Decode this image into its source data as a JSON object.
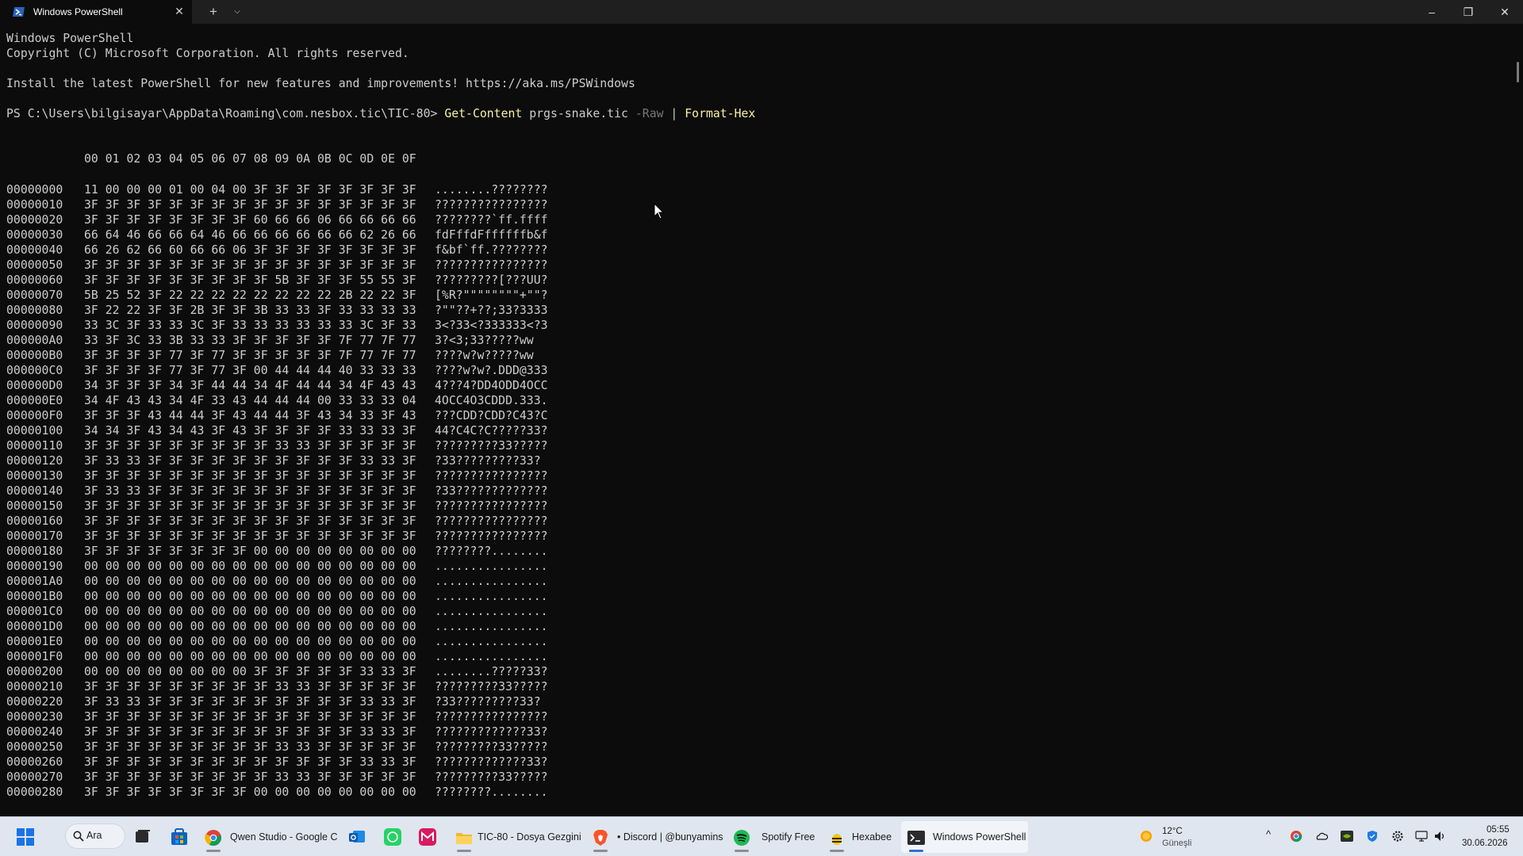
{
  "window": {
    "tab_title": "Windows PowerShell",
    "tab_close": "✕",
    "new_tab": "+",
    "tab_dropdown": "⌵",
    "minimize": "–",
    "maximize": "❐",
    "close": "✕"
  },
  "terminal": {
    "banner_1": "Windows PowerShell",
    "banner_2": "Copyright (C) Microsoft Corporation. All rights reserved.",
    "banner_3": "Install the latest PowerShell for new features and improvements! https://aka.ms/PSWindows",
    "prompt": "PS C:\\Users\\bilgisayar\\AppData\\Roaming\\com.nesbox.tic\\TIC-80> ",
    "cmd_1": "Get-Content",
    "arg_1": " prgs-snake.tic ",
    "param_1": "-Raw",
    "pipe": " | ",
    "cmd_2": "Format-Hex",
    "hex_header": "00 01 02 03 04 05 06 07 08 09 0A 0B 0C 0D 0E 0F",
    "rows": [
      {
        "offset": "00000000",
        "bytes": "11 00 00 00 01 00 04 00 3F 3F 3F 3F 3F 3F 3F 3F",
        "ascii": "........????????"
      },
      {
        "offset": "00000010",
        "bytes": "3F 3F 3F 3F 3F 3F 3F 3F 3F 3F 3F 3F 3F 3F 3F 3F",
        "ascii": "????????????????"
      },
      {
        "offset": "00000020",
        "bytes": "3F 3F 3F 3F 3F 3F 3F 3F 60 66 66 06 66 66 66 66",
        "ascii": "????????`ff.ffff"
      },
      {
        "offset": "00000030",
        "bytes": "66 64 46 66 66 64 46 66 66 66 66 66 66 62 26 66",
        "ascii": "fdFffdFffffffb&f"
      },
      {
        "offset": "00000040",
        "bytes": "66 26 62 66 60 66 66 06 3F 3F 3F 3F 3F 3F 3F 3F",
        "ascii": "f&bf`ff.????????"
      },
      {
        "offset": "00000050",
        "bytes": "3F 3F 3F 3F 3F 3F 3F 3F 3F 3F 3F 3F 3F 3F 3F 3F",
        "ascii": "????????????????"
      },
      {
        "offset": "00000060",
        "bytes": "3F 3F 3F 3F 3F 3F 3F 3F 3F 5B 3F 3F 3F 55 55 3F",
        "ascii": "?????????[???UU?"
      },
      {
        "offset": "00000070",
        "bytes": "5B 25 52 3F 22 22 22 22 22 22 22 22 2B 22 22 3F",
        "ascii": "[%R?\"\"\"\"\"\"\"\"+\"\"?"
      },
      {
        "offset": "00000080",
        "bytes": "3F 22 22 3F 3F 2B 3F 3F 3B 33 33 3F 33 33 33 33",
        "ascii": "?\"\"??+??;33?3333"
      },
      {
        "offset": "00000090",
        "bytes": "33 3C 3F 33 33 3C 3F 33 33 33 33 33 33 3C 3F 33",
        "ascii": "3<?33<?333333<?3"
      },
      {
        "offset": "000000A0",
        "bytes": "33 3F 3C 33 3B 33 33 3F 3F 3F 3F 3F 7F 77 7F 77",
        "ascii": "3?<3;33?????ww"
      },
      {
        "offset": "000000B0",
        "bytes": "3F 3F 3F 3F 77 3F 77 3F 3F 3F 3F 3F 7F 77 7F 77",
        "ascii": "????w?w?????ww"
      },
      {
        "offset": "000000C0",
        "bytes": "3F 3F 3F 3F 77 3F 77 3F 00 44 44 44 40 33 33 33",
        "ascii": "????w?w?.DDD@333"
      },
      {
        "offset": "000000D0",
        "bytes": "34 3F 3F 3F 34 3F 44 44 34 4F 44 44 34 4F 43 43",
        "ascii": "4???4?DD4ODD4OCC"
      },
      {
        "offset": "000000E0",
        "bytes": "34 4F 43 43 34 4F 33 43 44 44 44 00 33 33 33 04",
        "ascii": "4OCC4O3CDDD.333."
      },
      {
        "offset": "000000F0",
        "bytes": "3F 3F 3F 43 44 44 3F 43 44 44 3F 43 34 33 3F 43",
        "ascii": "???CDD?CDD?C43?C"
      },
      {
        "offset": "00000100",
        "bytes": "34 34 3F 43 34 43 3F 43 3F 3F 3F 3F 33 33 33 3F",
        "ascii": "44?C4C?C?????33?"
      },
      {
        "offset": "00000110",
        "bytes": "3F 3F 3F 3F 3F 3F 3F 3F 3F 33 33 3F 3F 3F 3F 3F",
        "ascii": "?????????33?????"
      },
      {
        "offset": "00000120",
        "bytes": "3F 33 33 3F 3F 3F 3F 3F 3F 3F 3F 3F 3F 33 33 3F",
        "ascii": "?33?????????33?"
      },
      {
        "offset": "00000130",
        "bytes": "3F 3F 3F 3F 3F 3F 3F 3F 3F 3F 3F 3F 3F 3F 3F 3F",
        "ascii": "????????????????"
      },
      {
        "offset": "00000140",
        "bytes": "3F 33 33 3F 3F 3F 3F 3F 3F 3F 3F 3F 3F 3F 3F 3F",
        "ascii": "?33?????????????"
      },
      {
        "offset": "00000150",
        "bytes": "3F 3F 3F 3F 3F 3F 3F 3F 3F 3F 3F 3F 3F 3F 3F 3F",
        "ascii": "????????????????"
      },
      {
        "offset": "00000160",
        "bytes": "3F 3F 3F 3F 3F 3F 3F 3F 3F 3F 3F 3F 3F 3F 3F 3F",
        "ascii": "????????????????"
      },
      {
        "offset": "00000170",
        "bytes": "3F 3F 3F 3F 3F 3F 3F 3F 3F 3F 3F 3F 3F 3F 3F 3F",
        "ascii": "????????????????"
      },
      {
        "offset": "00000180",
        "bytes": "3F 3F 3F 3F 3F 3F 3F 3F 00 00 00 00 00 00 00 00",
        "ascii": "????????........"
      },
      {
        "offset": "00000190",
        "bytes": "00 00 00 00 00 00 00 00 00 00 00 00 00 00 00 00",
        "ascii": "................"
      },
      {
        "offset": "000001A0",
        "bytes": "00 00 00 00 00 00 00 00 00 00 00 00 00 00 00 00",
        "ascii": "................"
      },
      {
        "offset": "000001B0",
        "bytes": "00 00 00 00 00 00 00 00 00 00 00 00 00 00 00 00",
        "ascii": "................"
      },
      {
        "offset": "000001C0",
        "bytes": "00 00 00 00 00 00 00 00 00 00 00 00 00 00 00 00",
        "ascii": "................"
      },
      {
        "offset": "000001D0",
        "bytes": "00 00 00 00 00 00 00 00 00 00 00 00 00 00 00 00",
        "ascii": "................"
      },
      {
        "offset": "000001E0",
        "bytes": "00 00 00 00 00 00 00 00 00 00 00 00 00 00 00 00",
        "ascii": "................"
      },
      {
        "offset": "000001F0",
        "bytes": "00 00 00 00 00 00 00 00 00 00 00 00 00 00 00 00",
        "ascii": "................"
      },
      {
        "offset": "00000200",
        "bytes": "00 00 00 00 00 00 00 00 3F 3F 3F 3F 3F 33 33 3F",
        "ascii": "........?????33?"
      },
      {
        "offset": "00000210",
        "bytes": "3F 3F 3F 3F 3F 3F 3F 3F 3F 33 33 3F 3F 3F 3F 3F",
        "ascii": "?????????33?????"
      },
      {
        "offset": "00000220",
        "bytes": "3F 33 33 3F 3F 3F 3F 3F 3F 3F 3F 3F 3F 33 33 3F",
        "ascii": "?33?????????33?"
      },
      {
        "offset": "00000230",
        "bytes": "3F 3F 3F 3F 3F 3F 3F 3F 3F 3F 3F 3F 3F 3F 3F 3F",
        "ascii": "????????????????"
      },
      {
        "offset": "00000240",
        "bytes": "3F 3F 3F 3F 3F 3F 3F 3F 3F 3F 3F 3F 3F 33 33 3F",
        "ascii": "?????????????33?"
      },
      {
        "offset": "00000250",
        "bytes": "3F 3F 3F 3F 3F 3F 3F 3F 3F 33 33 3F 3F 3F 3F 3F",
        "ascii": "?????????33?????"
      },
      {
        "offset": "00000260",
        "bytes": "3F 3F 3F 3F 3F 3F 3F 3F 3F 3F 3F 3F 3F 33 33 3F",
        "ascii": "?????????????33?"
      },
      {
        "offset": "00000270",
        "bytes": "3F 3F 3F 3F 3F 3F 3F 3F 3F 33 33 3F 3F 3F 3F 3F",
        "ascii": "?????????33?????"
      },
      {
        "offset": "00000280",
        "bytes": "3F 3F 3F 3F 3F 3F 3F 3F 00 00 00 00 00 00 00 00",
        "ascii": "????????........"
      }
    ]
  },
  "taskbar": {
    "search_label": "Ara",
    "items": [
      {
        "label": "Qwen Studio - Google C",
        "icon": "chrome-icon"
      },
      {
        "label": "TIC-80 - Dosya Gezgini",
        "icon": "folder-icon"
      },
      {
        "label": "• Discord | @bunyamins",
        "icon": "brave-icon"
      },
      {
        "label": "Spotify Free",
        "icon": "spotify-icon"
      },
      {
        "label": "Hexabee",
        "icon": "hexabee-icon"
      },
      {
        "label": "Windows PowerShell",
        "icon": "terminal-icon"
      }
    ],
    "weather_temp": "12°C",
    "weather_desc": "Güneşli",
    "time": "05:55",
    "date": "30.06.2026",
    "tray_chevron": "^"
  },
  "colors": {
    "terminal_bg": "#0c0c0c",
    "text": "#cccccc",
    "command": "#f9f1a5",
    "parameter": "#767676",
    "taskbar_bg": "#dfe6ef",
    "accent": "#2f6fd6"
  }
}
